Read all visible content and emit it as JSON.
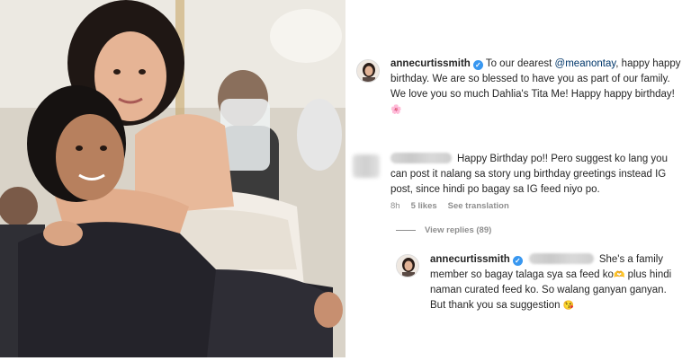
{
  "post_comment": {
    "username": "annecurtissmith",
    "mention": "@meanontay",
    "text_before": "To our dearest ",
    "text_after": ", happy happy birthday. We are so blessed to have you as part of our family. We love you so much Dahlia's Tita Me! Happy happy birthday! ",
    "emoji": "🌸"
  },
  "comment": {
    "text": "Happy Birthday po!! Pero suggest ko lang you can post it nalang sa story ung birthday greetings instead IG post, since hindi po bagay sa IG feed niyo po.",
    "time": "8h",
    "likes": "5 likes",
    "see_translation": "See translation",
    "view_replies": "View replies (89)"
  },
  "reply": {
    "username": "annecurtissmith",
    "text_1": "She's a family member so bagay talaga sya sa feed ko",
    "emoji_1": "🫶",
    "text_2": " plus hindi naman curated feed ko. So walang ganyan ganyan. But thank you sa suggestion ",
    "emoji_2": "😘"
  },
  "icons": {
    "verified": "verified-badge-icon",
    "verified_glyph": "✓"
  },
  "colors": {
    "verified": "#3897f0",
    "mention": "#00376b",
    "muted": "#8e8e8e"
  }
}
